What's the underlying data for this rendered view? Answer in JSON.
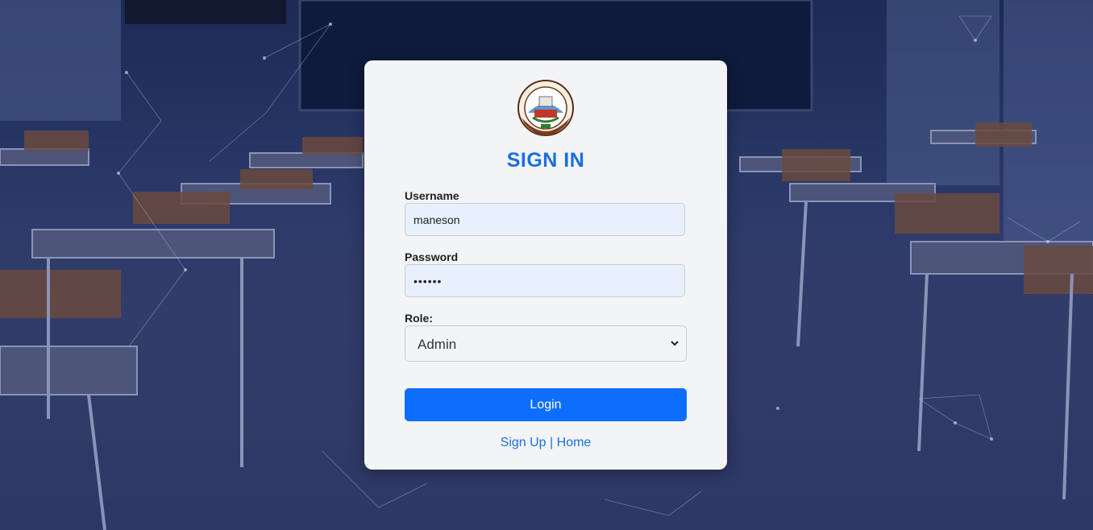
{
  "form": {
    "title": "SIGN IN",
    "username_label": "Username",
    "username_value": "maneson",
    "password_label": "Password",
    "password_value": "••••••",
    "role_label": "Role:",
    "role_value": "Admin",
    "login_label": "Login",
    "signup_link": "Sign Up",
    "separator": "|",
    "home_link": "Home"
  },
  "colors": {
    "accent": "#1a6fe0",
    "button": "#0d6efd",
    "card": "#f3f4f6",
    "input_fill": "#e8f0fe",
    "background": "#2a3868"
  }
}
